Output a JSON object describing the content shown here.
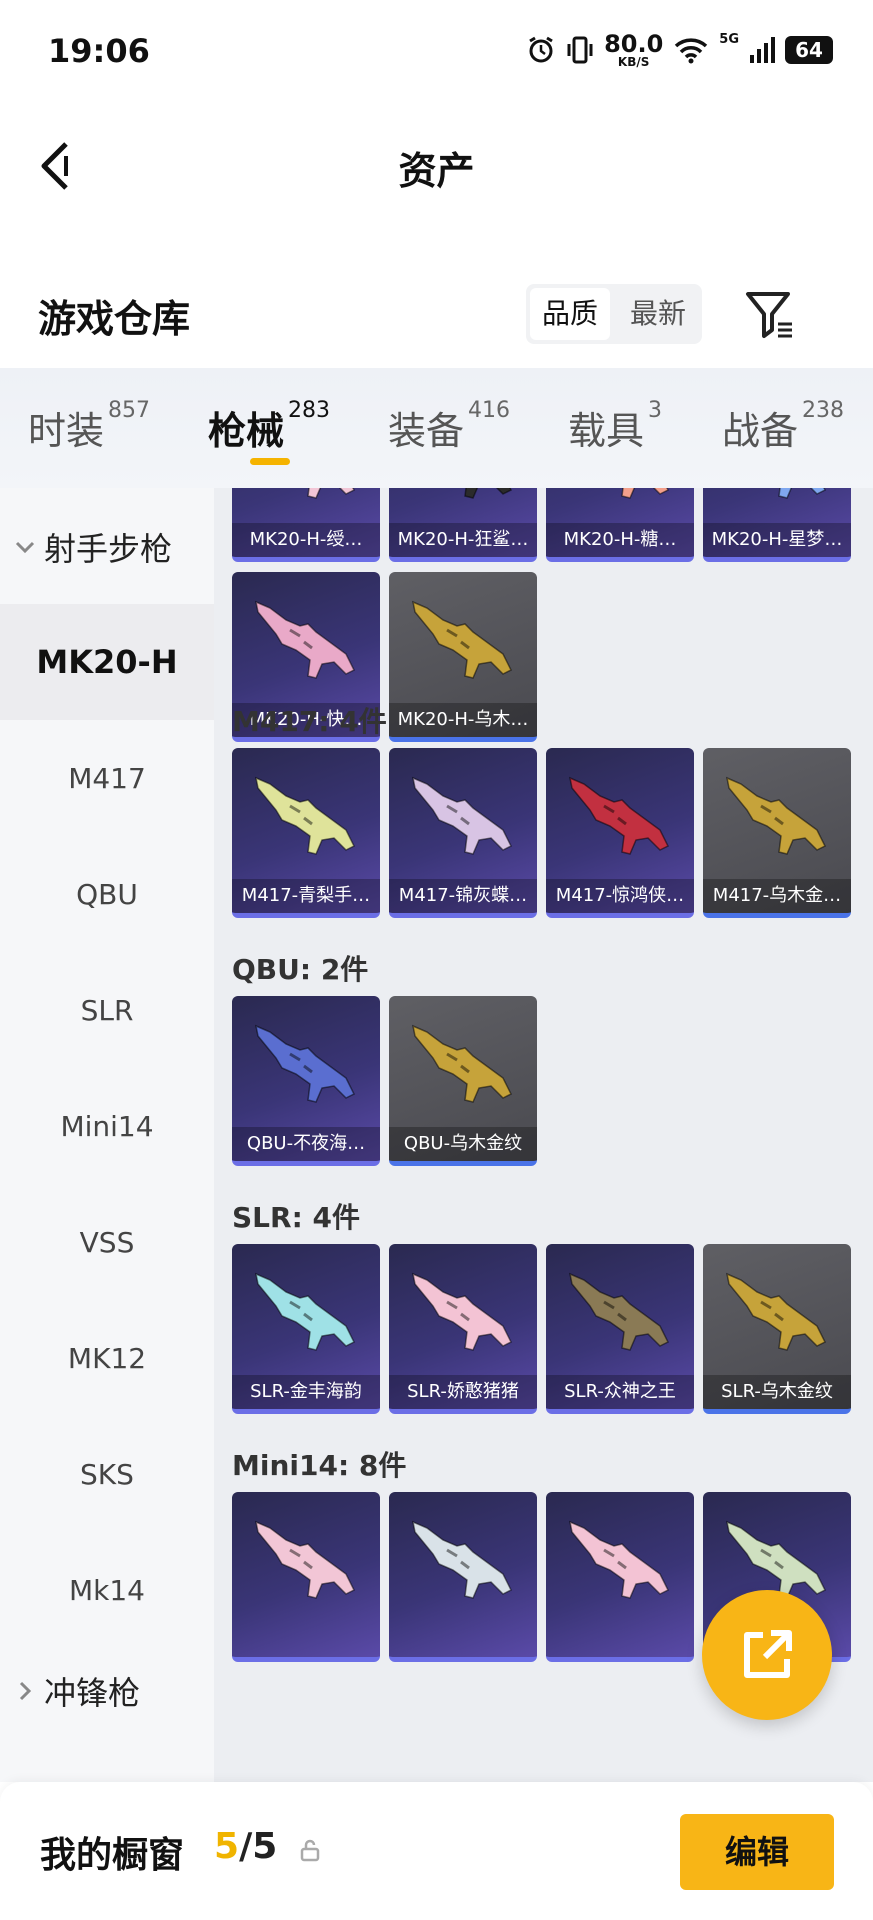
{
  "status": {
    "time": "19:06",
    "net_value": "80.0",
    "net_unit": "KB/S",
    "signal_label": "5G",
    "battery": "64"
  },
  "nav": {
    "title": "资产"
  },
  "header": {
    "title": "游戏仓库",
    "sort_options": [
      "品质",
      "最新"
    ],
    "sort_active": 0
  },
  "tabs": [
    {
      "label": "时装",
      "count": "857"
    },
    {
      "label": "枪械",
      "count": "283"
    },
    {
      "label": "装备",
      "count": "416"
    },
    {
      "label": "载具",
      "count": "3"
    },
    {
      "label": "战备",
      "count": "238"
    }
  ],
  "tab_active": 1,
  "sidebar": {
    "group1": "射手步枪",
    "items": [
      "MK20-H",
      "M417",
      "QBU",
      "SLR",
      "Mini14",
      "VSS",
      "MK12",
      "SKS",
      "Mk14"
    ],
    "active": 0,
    "group2": "冲锋枪"
  },
  "sections": [
    {
      "title": "",
      "items": [
        {
          "label": "MK20-H-绶…",
          "style": "purple",
          "color": "#f2c6d6"
        },
        {
          "label": "MK20-H-狂鲨…",
          "style": "purple",
          "color": "#2b2b2b"
        },
        {
          "label": "MK20-H-糖…",
          "style": "purple",
          "color": "#f4a08c"
        },
        {
          "label": "MK20-H-星梦…",
          "style": "purple",
          "color": "#7fa7ef"
        },
        {
          "label": "MK20-H-快…",
          "style": "purple",
          "color": "#e9a9c8"
        },
        {
          "label": "MK20-H-乌木…",
          "style": "grey",
          "color": "#c6a33a"
        }
      ]
    },
    {
      "title": "M417: 4件",
      "items": [
        {
          "label": "M417-青梨手…",
          "style": "purple",
          "color": "#dfe39a"
        },
        {
          "label": "M417-锦灰蝶…",
          "style": "purple",
          "color": "#d8c4e4"
        },
        {
          "label": "M417-惊鸿侠…",
          "style": "purple",
          "color": "#c23040"
        },
        {
          "label": "M417-乌木金…",
          "style": "grey",
          "color": "#c6a33a"
        }
      ]
    },
    {
      "title": "QBU: 2件",
      "items": [
        {
          "label": "QBU-不夜海…",
          "style": "purple",
          "color": "#5a6ed0"
        },
        {
          "label": "QBU-乌木金纹",
          "style": "grey",
          "color": "#c6a33a"
        }
      ]
    },
    {
      "title": "SLR: 4件",
      "items": [
        {
          "label": "SLR-金丰海韵",
          "style": "purple",
          "color": "#9fe1e6"
        },
        {
          "label": "SLR-娇憨猪猪",
          "style": "purple",
          "color": "#f3c3d4"
        },
        {
          "label": "SLR-众神之王",
          "style": "purple",
          "color": "#8a7a55"
        },
        {
          "label": "SLR-乌木金纹",
          "style": "grey",
          "color": "#c6a33a"
        }
      ]
    },
    {
      "title": "Mini14: 8件",
      "items": [
        {
          "label": "",
          "style": "purple",
          "color": "#f2c6d6"
        },
        {
          "label": "",
          "style": "purple",
          "color": "#d9e2e8"
        },
        {
          "label": "",
          "style": "purple",
          "color": "#f3c3d4"
        },
        {
          "label": "",
          "style": "purple",
          "color": "#cfe0c0"
        }
      ]
    }
  ],
  "bottom": {
    "label": "我的橱窗",
    "current": "5",
    "total": "/5",
    "edit_label": "编辑"
  },
  "colors": {
    "accent": "#f8b516",
    "card_purple": "#3a3577",
    "card_grey": "#55555b"
  }
}
